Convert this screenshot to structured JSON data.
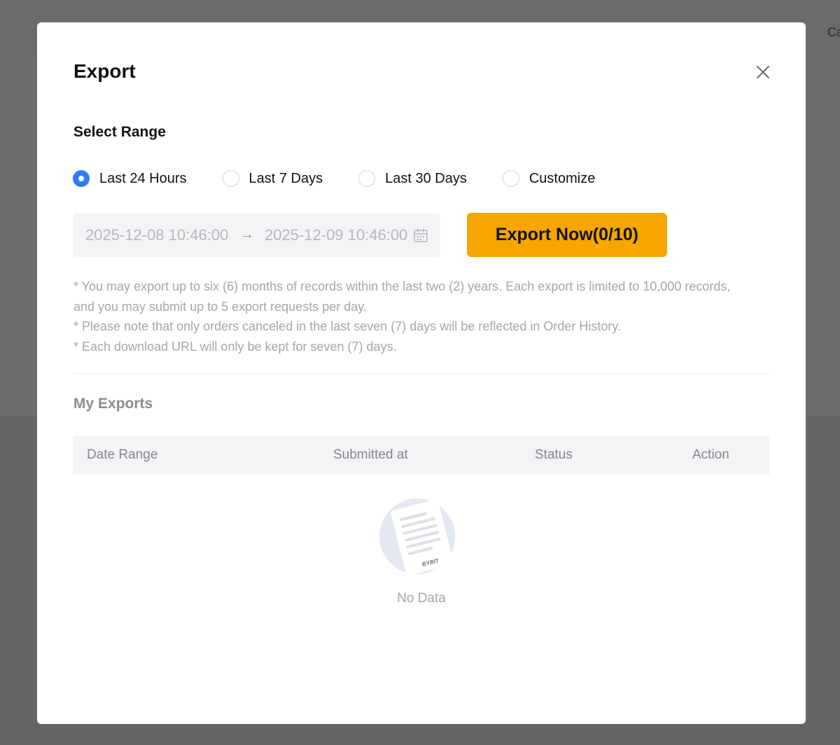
{
  "background": {
    "peek_text": "Ca"
  },
  "modal": {
    "title": "Export",
    "close_icon": "close-icon"
  },
  "range": {
    "title": "Select Range",
    "options": [
      {
        "label": "Last 24 Hours",
        "selected": true
      },
      {
        "label": "Last 7 Days",
        "selected": false
      },
      {
        "label": "Last 30 Days",
        "selected": false
      },
      {
        "label": "Customize",
        "selected": false
      }
    ],
    "start_date": "2025-12-08 10:46:00",
    "end_date": "2025-12-09 10:46:00",
    "arrow": "→",
    "calendar_icon": "calendar-icon"
  },
  "export_button": {
    "label": "Export Now(0/10)"
  },
  "notes": [
    "* You may export up to six (6) months of records within the last two (2) years. Each export is limited to 10,000 records, and you may submit up to 5 export requests per day.",
    "* Please note that only orders canceled in the last seven (7) days will be reflected in Order History.",
    "* Each download URL will only be kept for seven (7) days."
  ],
  "my_exports": {
    "title": "My Exports",
    "columns": [
      "Date Range",
      "Submitted at",
      "Status",
      "Action"
    ],
    "empty_text": "No Data",
    "illustration_brand": "BYBIT"
  },
  "colors": {
    "accent": "#f7a600",
    "radio_selected": "#2f7cf6"
  }
}
